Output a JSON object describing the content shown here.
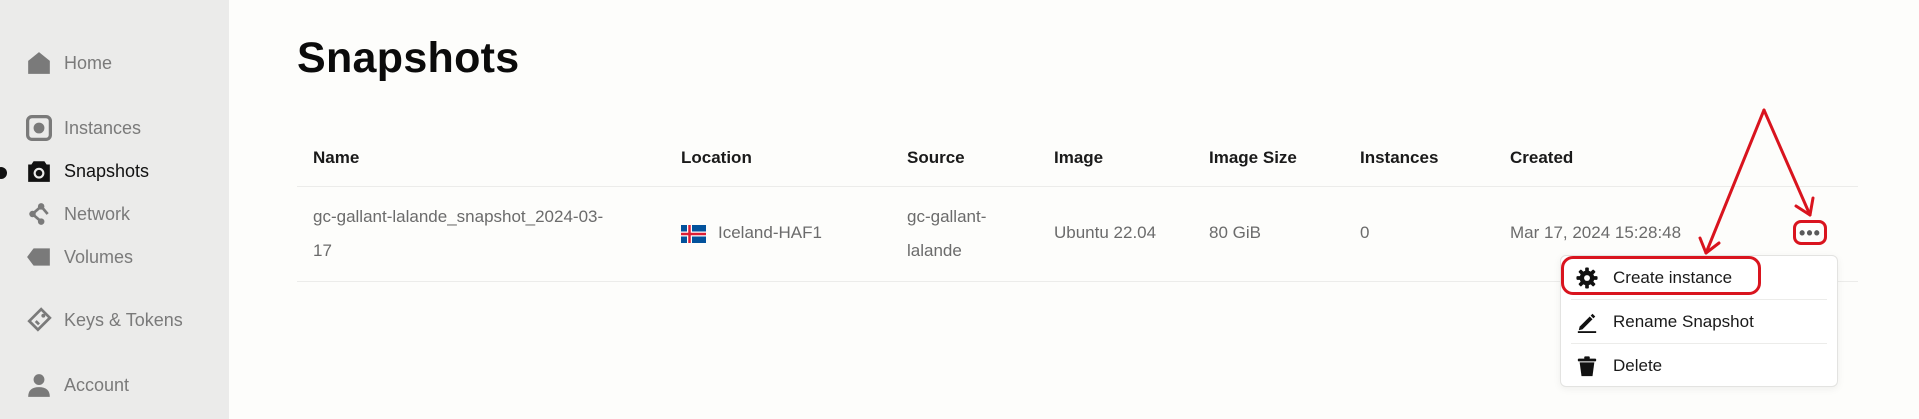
{
  "sidebar": {
    "items": [
      {
        "label": "Home",
        "icon": "home-icon"
      },
      {
        "label": "Instances",
        "icon": "instances-icon"
      },
      {
        "label": "Snapshots",
        "icon": "camera-icon",
        "active": true
      },
      {
        "label": "Network",
        "icon": "network-icon"
      },
      {
        "label": "Volumes",
        "icon": "tag-icon"
      },
      {
        "label": "Keys & Tokens",
        "icon": "key-tag-icon"
      },
      {
        "label": "Account",
        "icon": "user-icon"
      }
    ]
  },
  "page": {
    "title": "Snapshots"
  },
  "table": {
    "headers": [
      "Name",
      "Location",
      "Source",
      "Image",
      "Image Size",
      "Instances",
      "Created"
    ],
    "rows": [
      {
        "name": [
          "gc-gallant-lalande_snapshot_2024-03-",
          "17"
        ],
        "location": "Iceland-HAF1",
        "source": [
          "gc-gallant-",
          "lalande"
        ],
        "image": "Ubuntu 22.04",
        "image_size": "80 GiB",
        "instances": "0",
        "created": "Mar 17, 2024 15:28:48"
      }
    ]
  },
  "actions": {
    "more_label": "•••",
    "menu": [
      {
        "label": "Create instance",
        "icon": "gear-icon"
      },
      {
        "label": "Rename Snapshot",
        "icon": "pencil-icon"
      },
      {
        "label": "Delete",
        "icon": "trash-icon"
      }
    ]
  },
  "colors": {
    "annotation": "#d9141e",
    "sidebar_bg": "#ebebea",
    "page_bg": "#fdfdfb"
  }
}
